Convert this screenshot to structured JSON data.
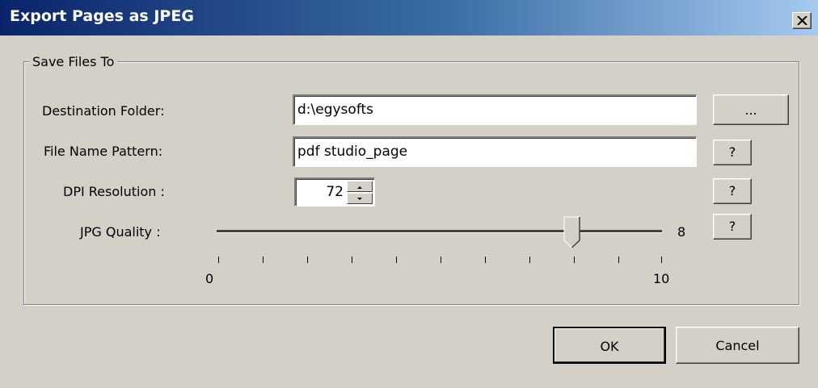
{
  "window": {
    "title": "Export Pages as JPEG",
    "close_icon": "close-icon"
  },
  "group": {
    "legend": "Save Files To"
  },
  "destination": {
    "label": "Destination Folder:",
    "value": "d:\\egysofts",
    "browse_label": "..."
  },
  "file_pattern": {
    "label": "File Name Pattern:",
    "value": "pdf studio_page",
    "help_label": "?"
  },
  "dpi": {
    "label": "DPI Resolution :",
    "value": "72",
    "help_label": "?"
  },
  "quality": {
    "label": "JPG Quality :",
    "value": "8",
    "min_label": "0",
    "max_label": "10",
    "level": 0.8,
    "help_label": "?"
  },
  "buttons": {
    "ok": "OK",
    "cancel": "Cancel"
  }
}
